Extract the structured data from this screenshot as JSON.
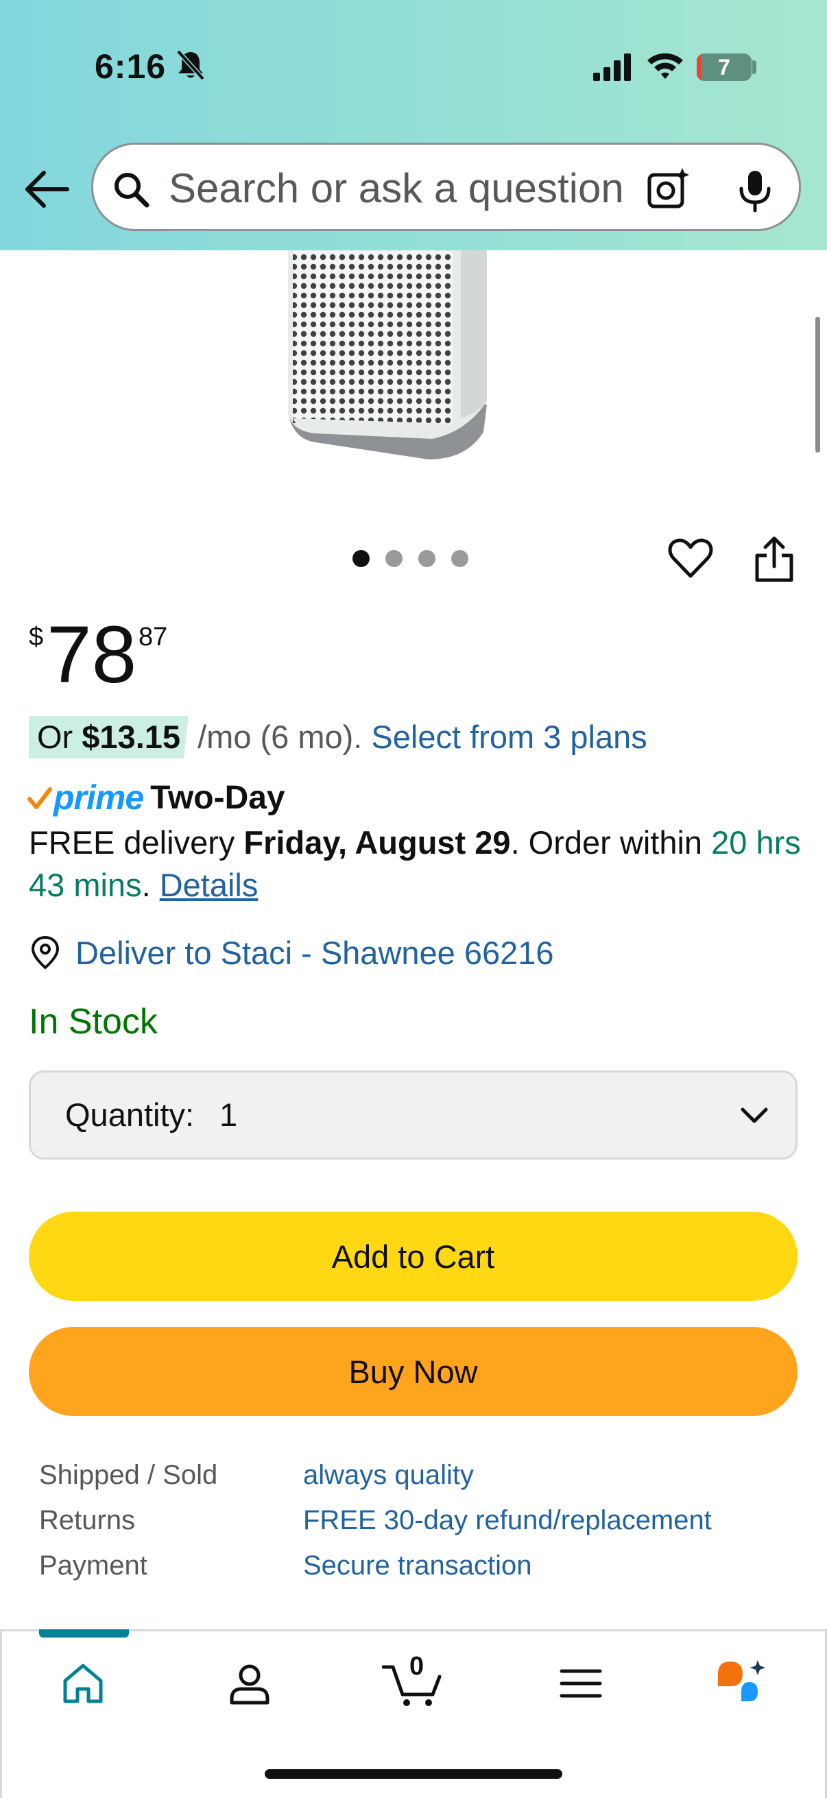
{
  "status_bar": {
    "time": "6:16",
    "battery_level": "7",
    "icons": [
      "bell-slash-icon",
      "cellular-signal-icon",
      "wifi-icon",
      "battery-icon"
    ]
  },
  "header": {
    "search_placeholder": "Search or ask a question",
    "icons": [
      "back-arrow-icon",
      "search-icon",
      "camera-lens-icon",
      "microphone-icon"
    ],
    "gradient_colors": [
      "#82d6dc",
      "#a6e6cf"
    ]
  },
  "gallery": {
    "image_count": 4,
    "active_index": 0,
    "icons": [
      "heart-icon",
      "share-icon"
    ]
  },
  "price": {
    "symbol": "$",
    "whole": "78",
    "fraction": "87"
  },
  "installment": {
    "prefix": "Or ",
    "amount": "$13.15",
    "term": " /mo (6 mo). ",
    "link": "Select from 3 plans"
  },
  "prime": {
    "brand": "prime",
    "label": "Two-Day",
    "brand_color": "#1399ff"
  },
  "delivery": {
    "prefix": "FREE delivery ",
    "date": "Friday, August 29",
    "middle": ". Order within ",
    "countdown": "20 hrs 43 mins",
    "suffix": ". ",
    "details_link": "Details"
  },
  "location": {
    "text": "Deliver to Staci - Shawnee 66216"
  },
  "stock": {
    "status": "In Stock",
    "color": "#007600"
  },
  "quantity": {
    "label": "Quantity:",
    "value": "1"
  },
  "buttons": {
    "add_to_cart": "Add to Cart",
    "buy_now": "Buy Now",
    "add_to_cart_color": "#ffd814",
    "buy_now_color": "#ffa41c"
  },
  "details": [
    {
      "label": "Shipped / Sold",
      "value": "always quality"
    },
    {
      "label": "Returns",
      "value": "FREE 30-day refund/replacement"
    },
    {
      "label": "Payment",
      "value": "Secure transaction"
    }
  ],
  "bottom_nav": {
    "cart_count": "0",
    "active_tab": "home",
    "accent_color": "#008296",
    "icons": [
      "home-icon",
      "account-icon",
      "cart-icon",
      "menu-icon",
      "rufus-icon"
    ]
  }
}
